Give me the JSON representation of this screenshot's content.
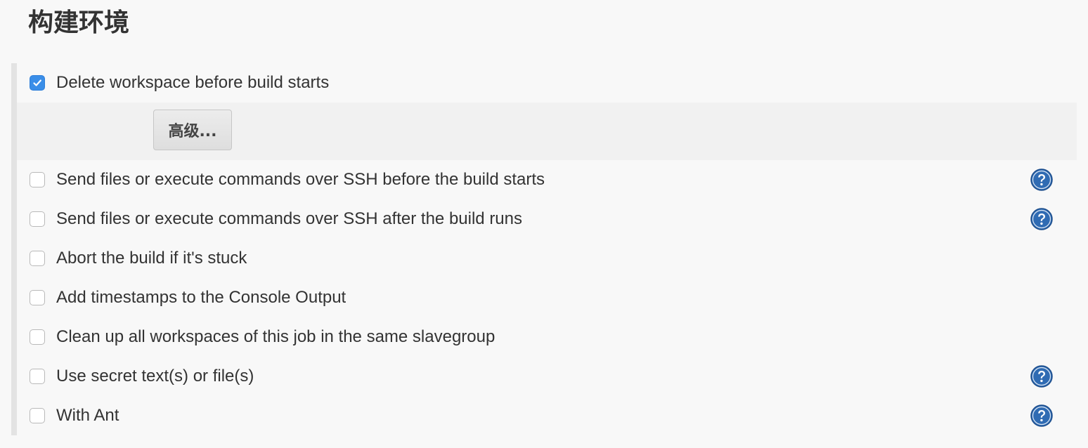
{
  "section": {
    "title": "构建环境"
  },
  "options": [
    {
      "label": "Delete workspace before build starts",
      "checked": true,
      "has_help": false
    },
    {
      "label": "Send files or execute commands over SSH before the build starts",
      "checked": false,
      "has_help": true
    },
    {
      "label": "Send files or execute commands over SSH after the build runs",
      "checked": false,
      "has_help": true
    },
    {
      "label": "Abort the build if it's stuck",
      "checked": false,
      "has_help": false
    },
    {
      "label": "Add timestamps to the Console Output",
      "checked": false,
      "has_help": false
    },
    {
      "label": "Clean up all workspaces of this job in the same slavegroup",
      "checked": false,
      "has_help": false
    },
    {
      "label": "Use secret text(s) or file(s)",
      "checked": false,
      "has_help": true
    },
    {
      "label": "With Ant",
      "checked": false,
      "has_help": true
    }
  ],
  "advanced": {
    "button_label": "高级..."
  },
  "colors": {
    "checkbox_checked": "#3a8ee8",
    "help_icon": "#2f6bb3"
  },
  "icons": {
    "checkbox_checked": "check-icon",
    "help": "help-icon"
  }
}
